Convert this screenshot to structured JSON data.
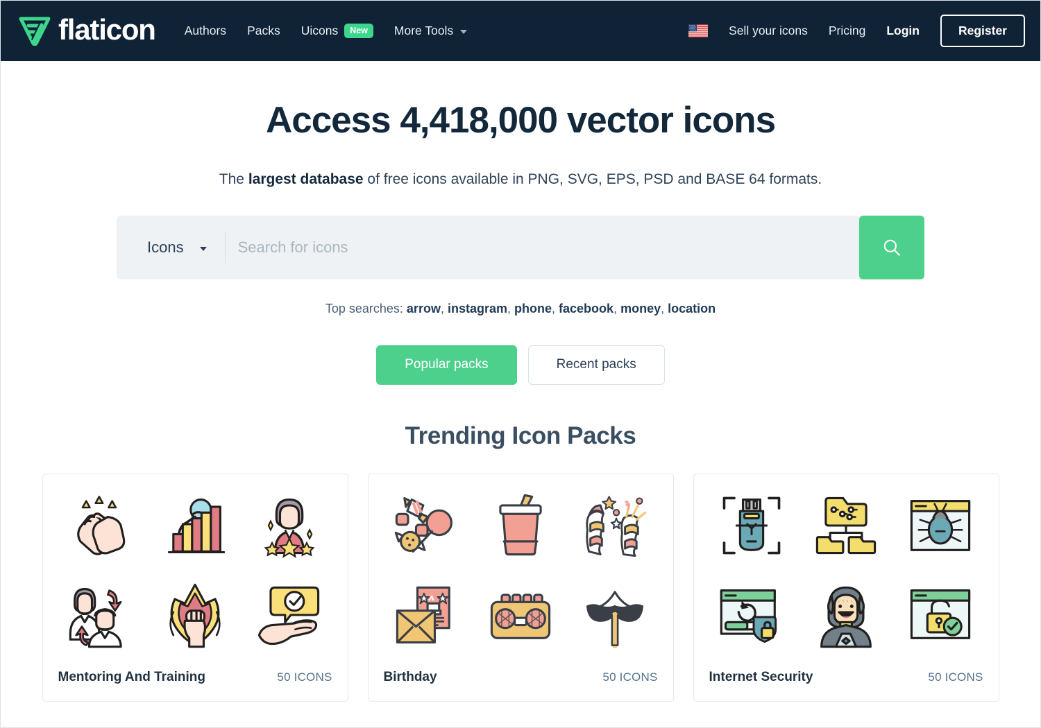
{
  "header": {
    "logo_text": "flaticon",
    "logo_icon": "flaticon-logo-icon",
    "nav": [
      {
        "label": "Authors",
        "badge": null,
        "caret": false
      },
      {
        "label": "Packs",
        "badge": null,
        "caret": false
      },
      {
        "label": "Uicons",
        "badge": "New",
        "caret": false
      },
      {
        "label": "More Tools",
        "badge": null,
        "caret": true
      }
    ],
    "flag_icon": "us-flag-icon",
    "sell_label": "Sell your icons",
    "pricing_label": "Pricing",
    "login_label": "Login",
    "register_label": "Register",
    "bg_color": "#0f2236",
    "accent_green": "#3dd68c"
  },
  "hero": {
    "title": "Access 4,418,000 vector icons",
    "icon_count": "4,418,000",
    "subtitle_prefix": "The ",
    "subtitle_bold": "largest database",
    "subtitle_suffix": " of free icons available in PNG, SVG, EPS, PSD and BASE 64 formats."
  },
  "search": {
    "type_label": "Icons",
    "type_options": [
      "Icons"
    ],
    "placeholder": "Search for icons",
    "value": "",
    "button_icon": "search-icon",
    "button_color": "#4ed08d"
  },
  "top_searches": {
    "label": "Top searches:",
    "terms": [
      "arrow",
      "instagram",
      "phone",
      "facebook",
      "money",
      "location"
    ]
  },
  "pack_toggle": {
    "popular_label": "Popular packs",
    "recent_label": "Recent packs",
    "active": "popular"
  },
  "trending": {
    "section_title": "Trending Icon Packs",
    "cards": [
      {
        "name": "Mentoring And Training",
        "count": "50 ICONS",
        "icons": [
          "clapping-hands-icon",
          "growth-chart-climber-icon",
          "star-employee-icon",
          "people-exchange-icon",
          "fist-power-icon",
          "hand-approval-icon"
        ]
      },
      {
        "name": "Birthday",
        "count": "50 ICONS",
        "icons": [
          "candy-lollipop-icon",
          "drink-cup-icon",
          "party-popper-icon",
          "invitation-envelope-icon",
          "boombox-radio-icon",
          "moustache-prop-icon"
        ]
      },
      {
        "name": "Internet Security",
        "count": "50 ICONS",
        "icons": [
          "usb-scan-icon",
          "folder-network-icon",
          "browser-bug-icon",
          "browser-backup-shield-icon",
          "hacker-avatar-icon",
          "browser-unlocked-check-icon"
        ]
      }
    ]
  }
}
